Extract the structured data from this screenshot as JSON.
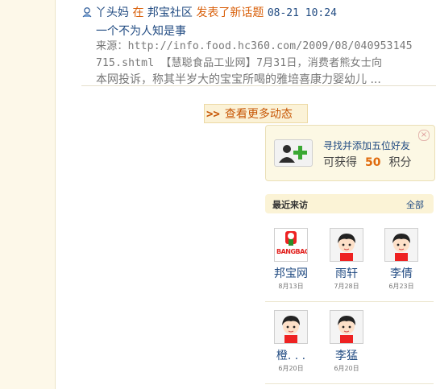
{
  "feed": {
    "user": "丫头妈",
    "in_word": "在",
    "community": "邦宝社区",
    "action": "发表了新话题",
    "time": "08-21 10:24",
    "topic_title": "一个不为人知是事",
    "body_line1": "来源：http://info.food.hc360.com/2009/08/040953145",
    "body_line2": "715.shtml 【慧聪食品工业网】7月31日，消费者熊女士向",
    "body_line3": "本网投诉，称其半岁大的宝宝所喝的雅培喜康力婴幼儿 ..."
  },
  "more_button": {
    "arrow": ">>",
    "label": "查看更多动态"
  },
  "friend_finder": {
    "title": "寻找并添加五位好友",
    "reward_prefix": "可获得",
    "points": "50",
    "reward_suffix": "积分",
    "close": "×"
  },
  "recent_visitors": {
    "title": "最近来访",
    "all_link": "全部",
    "items": [
      {
        "name": "邦宝网",
        "date": "8月13日",
        "avatar": "bangbao-toys-logo"
      },
      {
        "name": "雨轩",
        "date": "7月28日",
        "avatar": "cartoon-boy-avatar"
      },
      {
        "name": "李倩",
        "date": "6月23日",
        "avatar": "cartoon-boy-avatar"
      },
      {
        "name": "橙. . .",
        "date": "6月20日",
        "avatar": "cartoon-boy-avatar"
      },
      {
        "name": "李猛",
        "date": "6月20日",
        "avatar": "cartoon-boy-avatar"
      }
    ],
    "logo_text": "BANGBAO TOYS"
  },
  "colors": {
    "link": "#214b82",
    "accent": "#d9600b",
    "points": "#e06a0c"
  }
}
